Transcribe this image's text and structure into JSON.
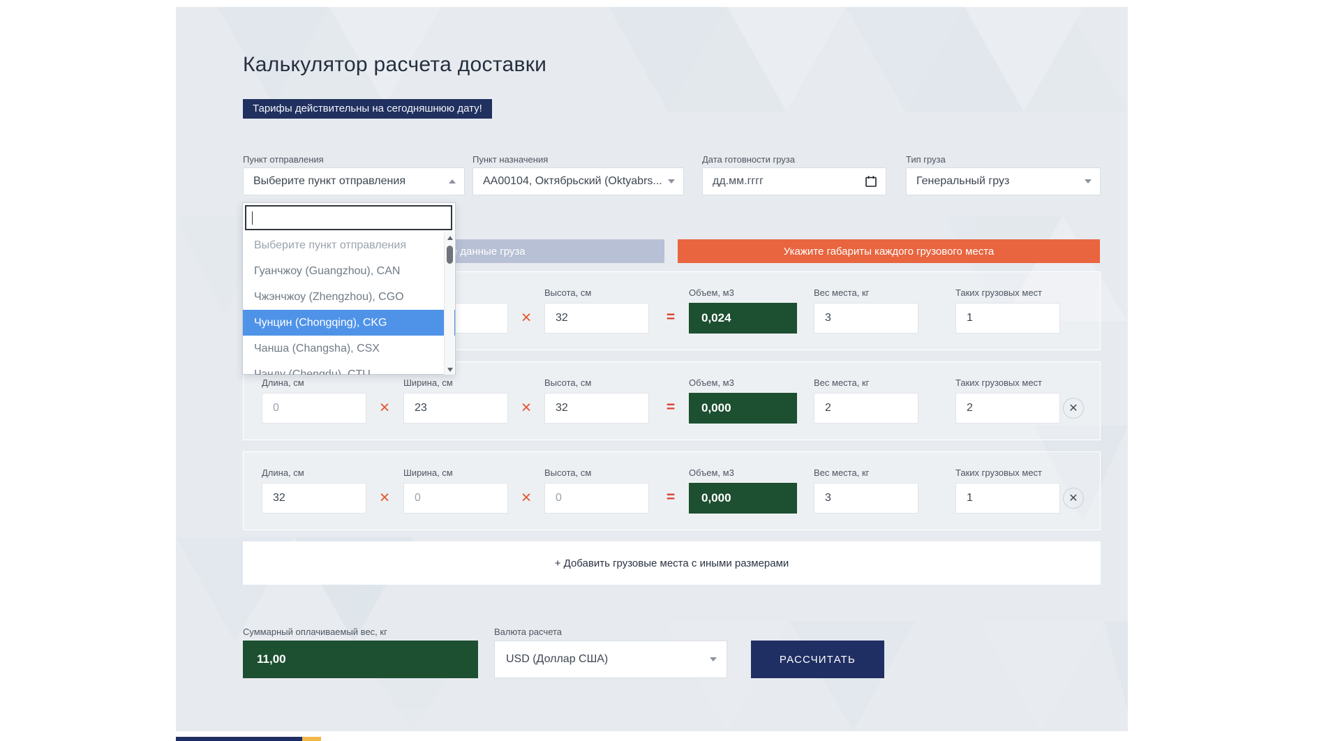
{
  "page": {
    "title": "Калькулятор расчета доставки",
    "badge": "Тарифы действительны на сегодняшнюю дату!"
  },
  "form": {
    "departure": {
      "label": "Пункт отправления",
      "value": "Выберите пункт отправления"
    },
    "destination": {
      "label": "Пункт назначения",
      "value": "AA00104, Октябрьский (Oktyabrs..."
    },
    "ready_date": {
      "label": "Дата готовности груза",
      "placeholder": "дд.мм.гггг"
    },
    "cargo_type": {
      "label": "Тип груза",
      "value": "Генеральный груз"
    }
  },
  "departure_dropdown": {
    "search_value": "",
    "options": [
      {
        "label": "Выберите пункт отправления",
        "state": "placeholder"
      },
      {
        "label": "Гуанчжоу (Guangzhou), CAN",
        "state": "normal"
      },
      {
        "label": "Чжэнчжоу (Zhengzhou), CGO",
        "state": "normal"
      },
      {
        "label": "Чунцин (Chongqing), CKG",
        "state": "highlighted"
      },
      {
        "label": "Чанша (Changsha), CSX",
        "state": "normal"
      },
      {
        "label": "Чэнду (Chengdu), CTU",
        "state": "clipped"
      }
    ]
  },
  "mode_buttons": {
    "general": "Укажите общие данные груза",
    "dimensions": "Укажите габариты каждого грузового места"
  },
  "cargo": {
    "labels": {
      "length": "Длина, см",
      "width": "Ширина, см",
      "height": "Высота, см",
      "volume": "Объем, м3",
      "weight": "Вес места, кг",
      "count": "Таких грузовых мест"
    },
    "rows": [
      {
        "length": "",
        "width": "",
        "height": "32",
        "volume": "0,024",
        "weight": "3",
        "count": "1"
      },
      {
        "length": "0",
        "width": "23",
        "height": "32",
        "volume": "0,000",
        "weight": "2",
        "count": "2"
      },
      {
        "length": "32",
        "width": "0",
        "height": "0",
        "volume": "0,000",
        "weight": "3",
        "count": "1"
      }
    ],
    "multiply_sign": "×",
    "equals_sign": "=",
    "remove_sign": "✕",
    "add_button": "+ Добавить грузовые места с иными размерами"
  },
  "summary": {
    "total_weight": {
      "label": "Суммарный оплачиваемый вес, кг",
      "value": "11,00"
    },
    "currency": {
      "label": "Валюта расчета",
      "value": "USD (Доллар США)"
    },
    "calculate_button": "РАССЧИТАТЬ"
  },
  "colors": {
    "panel_bg": "#e7ebef",
    "accent_navy": "#202f63",
    "accent_orange": "#e8653f",
    "accent_green": "#1d4f31",
    "highlight_blue": "#4f93e8",
    "multiply_red": "#e2572f"
  }
}
